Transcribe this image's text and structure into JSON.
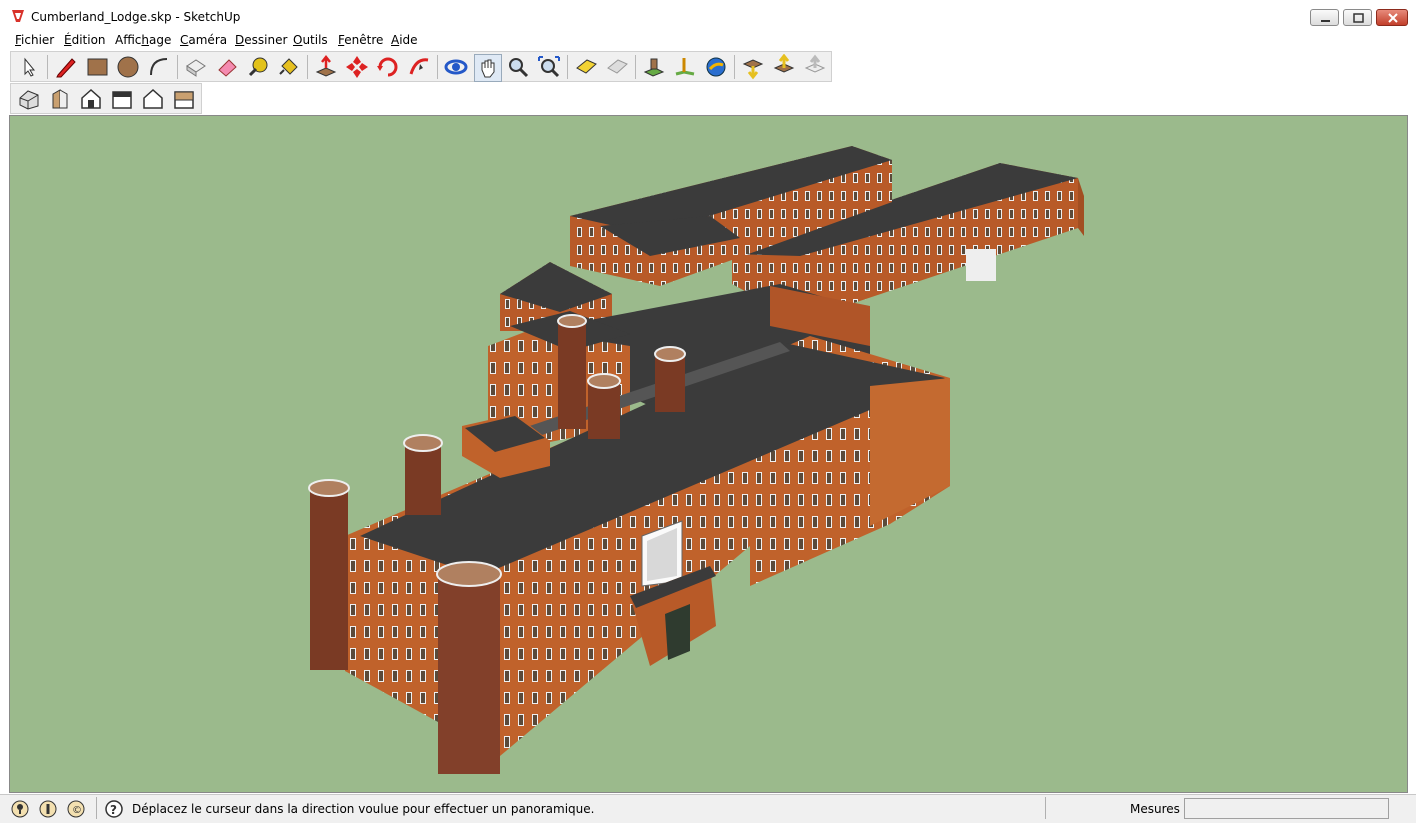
{
  "window": {
    "title": "Cumberland_Lodge.skp - SketchUp",
    "controls": {
      "minimize": "minimize",
      "maximize": "maximize",
      "close": "close"
    }
  },
  "menu": [
    {
      "label": "Fichier",
      "underline": "F",
      "rest": "ichier"
    },
    {
      "label": "Édition",
      "underline": "É",
      "rest": "dition"
    },
    {
      "label": "Affichage",
      "pre": "Affic",
      "underline": "h",
      "rest": "age"
    },
    {
      "label": "Caméra",
      "underline": "C",
      "rest": "améra"
    },
    {
      "label": "Dessiner",
      "underline": "D",
      "rest": "essiner"
    },
    {
      "label": "Outils",
      "underline": "O",
      "rest": "utils"
    },
    {
      "label": "Fenêtre",
      "underline": "F",
      "rest": "enêtre"
    },
    {
      "label": "Aide",
      "underline": "A",
      "rest": "ide"
    }
  ],
  "toolbar_main": [
    "select-tool",
    "pencil-tool",
    "rectangle-tool",
    "circle-tool",
    "arc-tool",
    "make-component-tool",
    "eraser-tool",
    "tape-measure-tool",
    "paint-bucket-tool",
    "push-pull-tool",
    "move-tool",
    "rotate-tool",
    "follow-me-tool",
    "orbit-tool",
    "pan-tool",
    "zoom-tool",
    "zoom-extents-tool",
    "previous-view-tool",
    "next-view-tool",
    "add-location-tool",
    "toggle-terrain-tool",
    "google-earth-tool",
    "get-models-tool",
    "share-model-tool",
    "share-component-tool"
  ],
  "toolbar_views": [
    "iso-view",
    "front-view",
    "top-view",
    "right-view",
    "back-view",
    "left-view"
  ],
  "status": {
    "message": "Déplacez le curseur dans la direction voulue pour effectuer un panoramique.",
    "measure_label": "Mesures",
    "measure_value": ""
  },
  "colors": {
    "viewport_bg": "#9bba8c",
    "roof": "#3b3b3b",
    "brick": "#c0622b",
    "brick_dark": "#8a3b1e",
    "window": "#f0f0f0"
  }
}
